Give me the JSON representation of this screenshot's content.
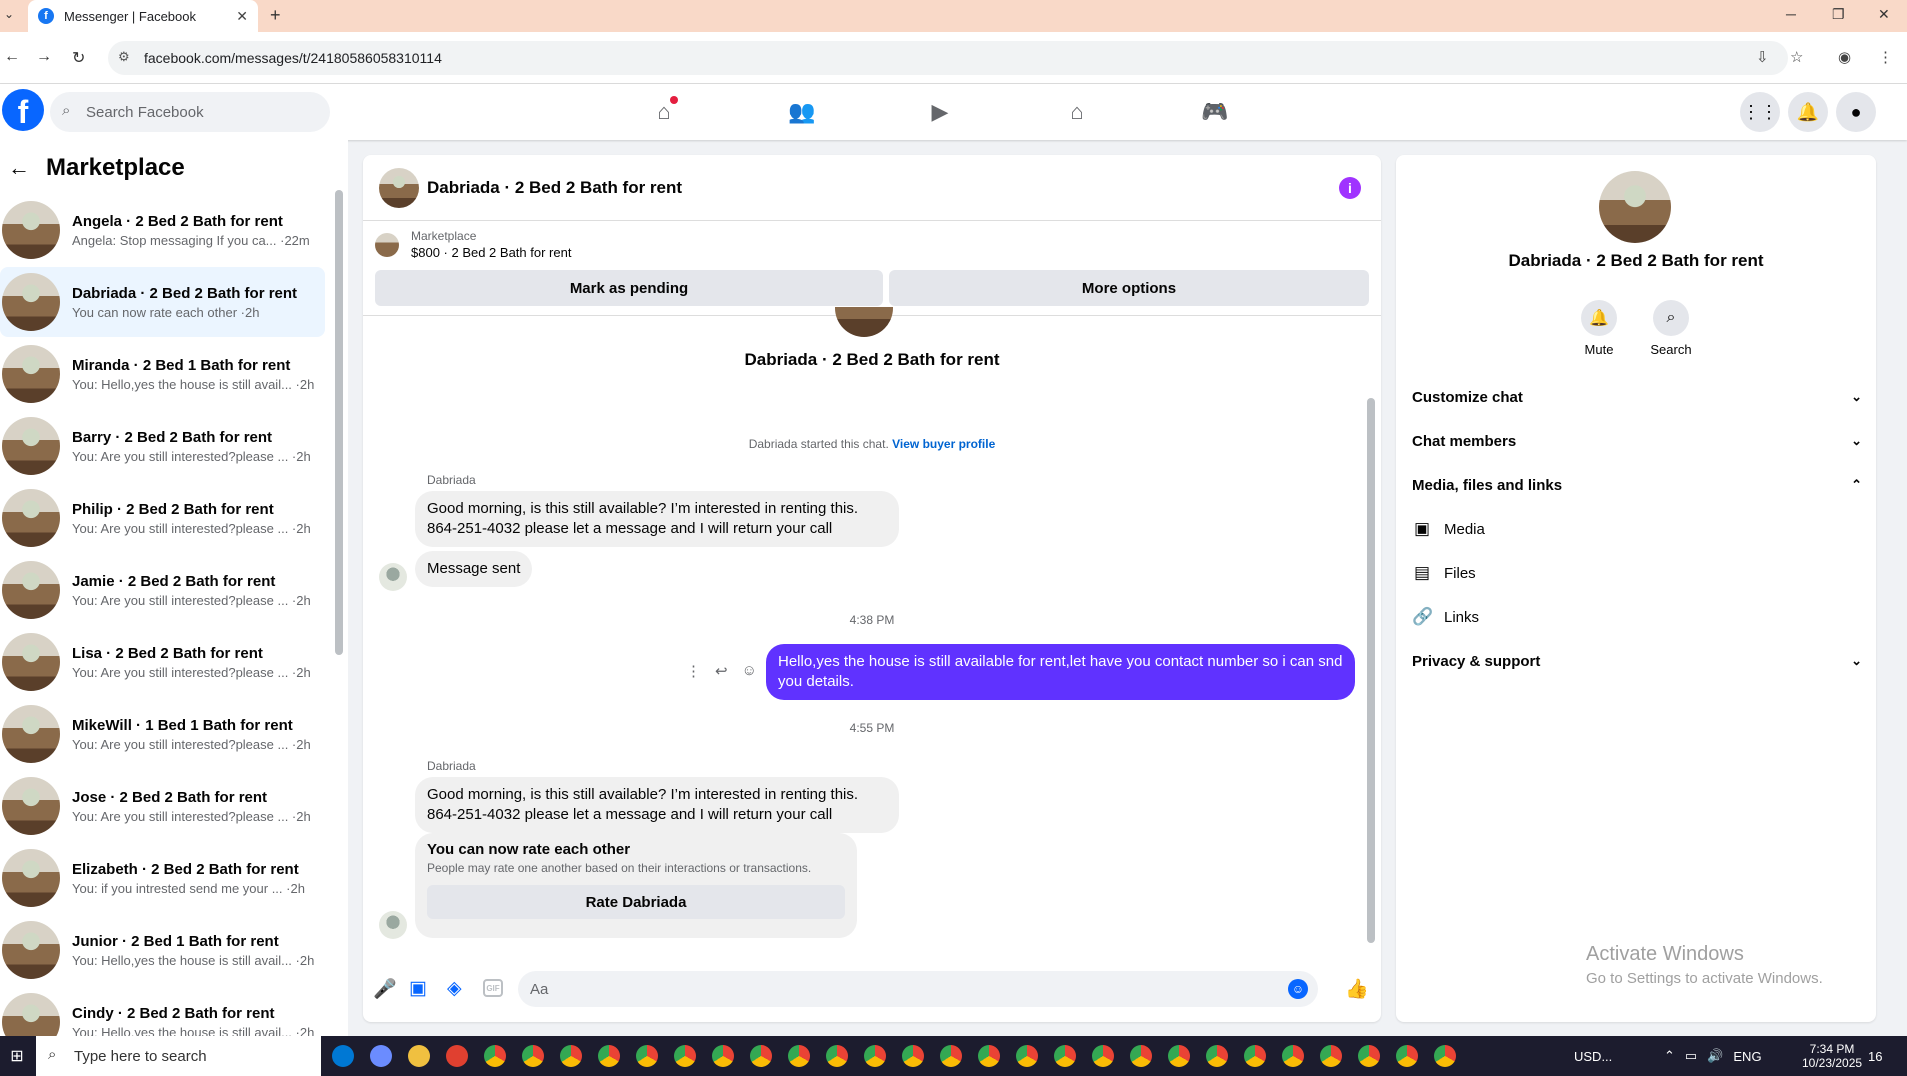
{
  "browser": {
    "tab_title": "Messenger | Facebook",
    "url": "facebook.com/messages/t/24180586058310114"
  },
  "fb": {
    "search_placeholder": "Search Facebook"
  },
  "sidebar": {
    "title": "Marketplace",
    "conversations": [
      {
        "name": "Angela · 2 Bed 2 Bath for rent",
        "preview": "Angela: Stop messaging If you ca... ·22m"
      },
      {
        "name": "Dabriada · 2 Bed 2 Bath for rent",
        "preview": "You can now rate each other ·2h"
      },
      {
        "name": "Miranda · 2 Bed 1 Bath for rent",
        "preview": "You: Hello,yes the house is still avail... ·2h"
      },
      {
        "name": "Barry · 2 Bed 2 Bath for rent",
        "preview": "You: Are you still interested?please ... ·2h"
      },
      {
        "name": "Philip · 2 Bed 2 Bath for rent",
        "preview": "You: Are you still interested?please ... ·2h"
      },
      {
        "name": "Jamie · 2 Bed 2 Bath for rent",
        "preview": "You: Are you still interested?please ... ·2h"
      },
      {
        "name": "Lisa · 2 Bed 2 Bath for rent",
        "preview": "You: Are you still interested?please ... ·2h"
      },
      {
        "name": "MikeWill · 1 Bed 1 Bath for rent",
        "preview": "You: Are you still interested?please ... ·2h"
      },
      {
        "name": "Jose · 2 Bed 2 Bath for rent",
        "preview": "You: Are you still interested?please ... ·2h"
      },
      {
        "name": "Elizabeth · 2 Bed 2 Bath for rent",
        "preview": "You: if you intrested send me your ... ·2h"
      },
      {
        "name": "Junior · 2 Bed 1 Bath for rent",
        "preview": "You: Hello,yes the house is still avail... ·2h"
      },
      {
        "name": "Cindy · 2 Bed 2 Bath for rent",
        "preview": "You: Hello,yes the house is still avail... ·2h"
      }
    ]
  },
  "chat": {
    "title": "Dabriada · 2 Bed 2 Bath for rent",
    "marketplace_label": "Marketplace",
    "listing": "$800 · 2 Bed 2 Bath for rent",
    "mark_pending": "Mark as pending",
    "more_options": "More options",
    "started_text": "Dabriada started this chat.",
    "view_profile": "View buyer profile",
    "sender": "Dabriada",
    "msg1": "Good morning, is this still available? I’m interested in renting this. 864-251-4032 please let a message and I will return your call",
    "msg_sent": "Message sent",
    "time1": "4:38 PM",
    "my_msg": "Hello,yes the house is still available for rent,let have you contact number so i can snd you details.",
    "time2": "4:55 PM",
    "msg2": "Good morning, is this still available? I’m interested in renting this. 864-251-4032 please let a message and I will return your call",
    "rate_title": "You can now rate each other",
    "rate_desc": "People may rate one another based on their interactions or transactions.",
    "rate_button": "Rate Dabriada",
    "input_placeholder": "Aa"
  },
  "details": {
    "name": "Dabriada · 2 Bed 2 Bath for rent",
    "mute": "Mute",
    "search": "Search",
    "customize": "Customize chat",
    "members": "Chat members",
    "media_section": "Media, files and links",
    "media": "Media",
    "files": "Files",
    "links": "Links",
    "privacy": "Privacy & support"
  },
  "watermark": {
    "line1": "Activate Windows",
    "line2": "Go to Settings to activate Windows."
  },
  "taskbar": {
    "search_placeholder": "Type here to search",
    "ticker": "USD...",
    "lang": "ENG",
    "time": "7:34 PM",
    "date": "10/23/2025",
    "notif": "16"
  }
}
